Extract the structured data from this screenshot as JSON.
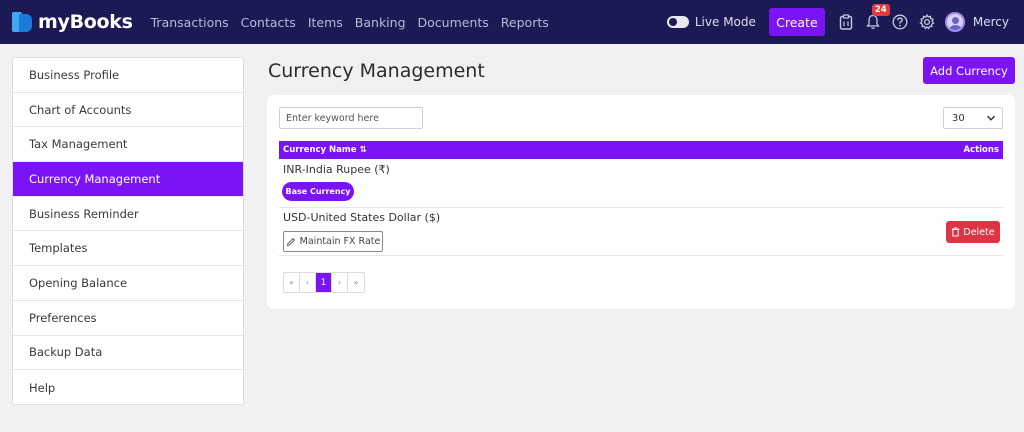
{
  "app": {
    "name": "myBooks",
    "nav": [
      "Transactions",
      "Contacts",
      "Items",
      "Banking",
      "Documents",
      "Reports"
    ],
    "live_mode_label": "Live Mode",
    "create_label": "Create",
    "notification_count": "24",
    "user_name": "Mercy"
  },
  "sidebar": {
    "items": [
      {
        "label": "Business Profile"
      },
      {
        "label": "Chart of Accounts"
      },
      {
        "label": "Tax Management"
      },
      {
        "label": "Currency Management",
        "active": true
      },
      {
        "label": "Business Reminder"
      },
      {
        "label": "Templates"
      },
      {
        "label": "Opening Balance"
      },
      {
        "label": "Preferences"
      },
      {
        "label": "Backup Data"
      },
      {
        "label": "Help"
      }
    ]
  },
  "main": {
    "title": "Currency Management",
    "add_button": "Add Currency",
    "search_placeholder": "Enter keyword here",
    "per_page": "30",
    "columns": {
      "name": "Currency Name ⇅",
      "actions": "Actions"
    },
    "rows": [
      {
        "name": "INR-India Rupee (₹)",
        "tag": "Base Currency"
      },
      {
        "name": "USD-United States Dollar ($)",
        "fx_button": "Maintain FX Rate",
        "delete": "Delete"
      }
    ],
    "pagination": {
      "first": "«",
      "prev": "‹",
      "current": "1",
      "next": "›",
      "last": "»"
    }
  },
  "colors": {
    "accent": "#7b14f5",
    "topbar": "#1c1a55",
    "danger": "#dc3545"
  }
}
